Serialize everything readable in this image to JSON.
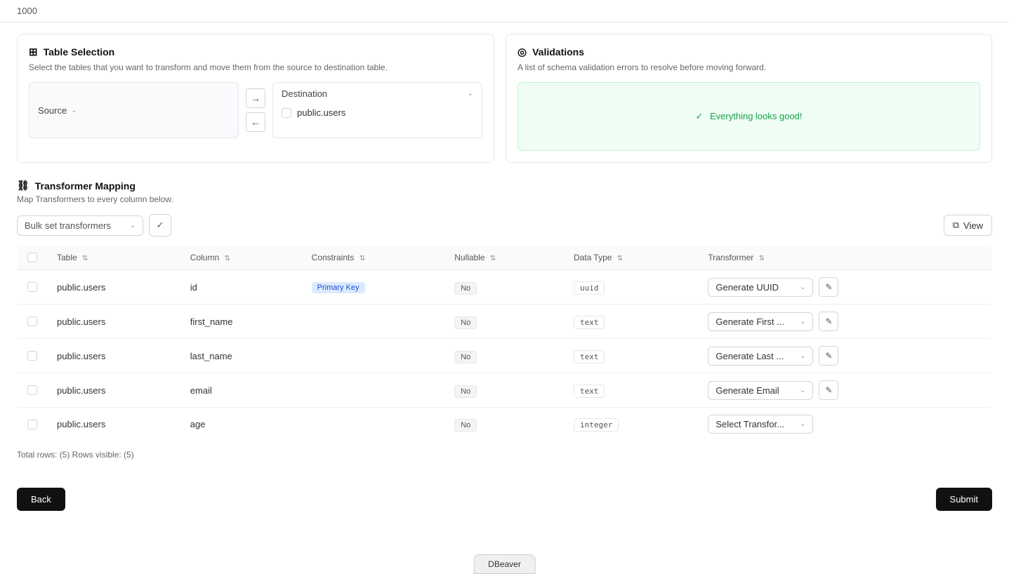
{
  "topBar": {
    "value": "1000"
  },
  "tableSelection": {
    "title": "Table Selection",
    "description": "Select the tables that you want to transform and move them from the source to destination table.",
    "sourceLabel": "Source",
    "destinationLabel": "Destination",
    "destinationItem": "public.users",
    "arrowRight": "→",
    "arrowLeft": "←"
  },
  "validations": {
    "title": "Validations",
    "description": "A list of schema validation errors to resolve before moving forward.",
    "successMessage": "Everything looks good!"
  },
  "transformerMapping": {
    "title": "Transformer Mapping",
    "description": "Map Transformers to every column below.",
    "bulkPlaceholder": "Bulk set transformers",
    "viewLabel": "View",
    "columns": {
      "table": "Table",
      "column": "Column",
      "constraints": "Constraints",
      "nullable": "Nullable",
      "dataType": "Data Type",
      "transformer": "Transformer"
    },
    "rows": [
      {
        "table": "public.users",
        "column": "id",
        "constraint": "Primary Key",
        "nullable": "No",
        "dataType": "uuid",
        "transformer": "Generate UUID"
      },
      {
        "table": "public.users",
        "column": "first_name",
        "constraint": "",
        "nullable": "No",
        "dataType": "text",
        "transformer": "Generate First ..."
      },
      {
        "table": "public.users",
        "column": "last_name",
        "constraint": "",
        "nullable": "No",
        "dataType": "text",
        "transformer": "Generate Last ..."
      },
      {
        "table": "public.users",
        "column": "email",
        "constraint": "",
        "nullable": "No",
        "dataType": "text",
        "transformer": "Generate Email"
      },
      {
        "table": "public.users",
        "column": "age",
        "constraint": "",
        "nullable": "No",
        "dataType": "integer",
        "transformer": "Select Transfor..."
      }
    ],
    "totalRows": "Total rows: (5) Rows visible: (5)"
  },
  "footer": {
    "backLabel": "Back",
    "submitLabel": "Submit"
  },
  "taskbar": {
    "label": "DBeaver"
  }
}
